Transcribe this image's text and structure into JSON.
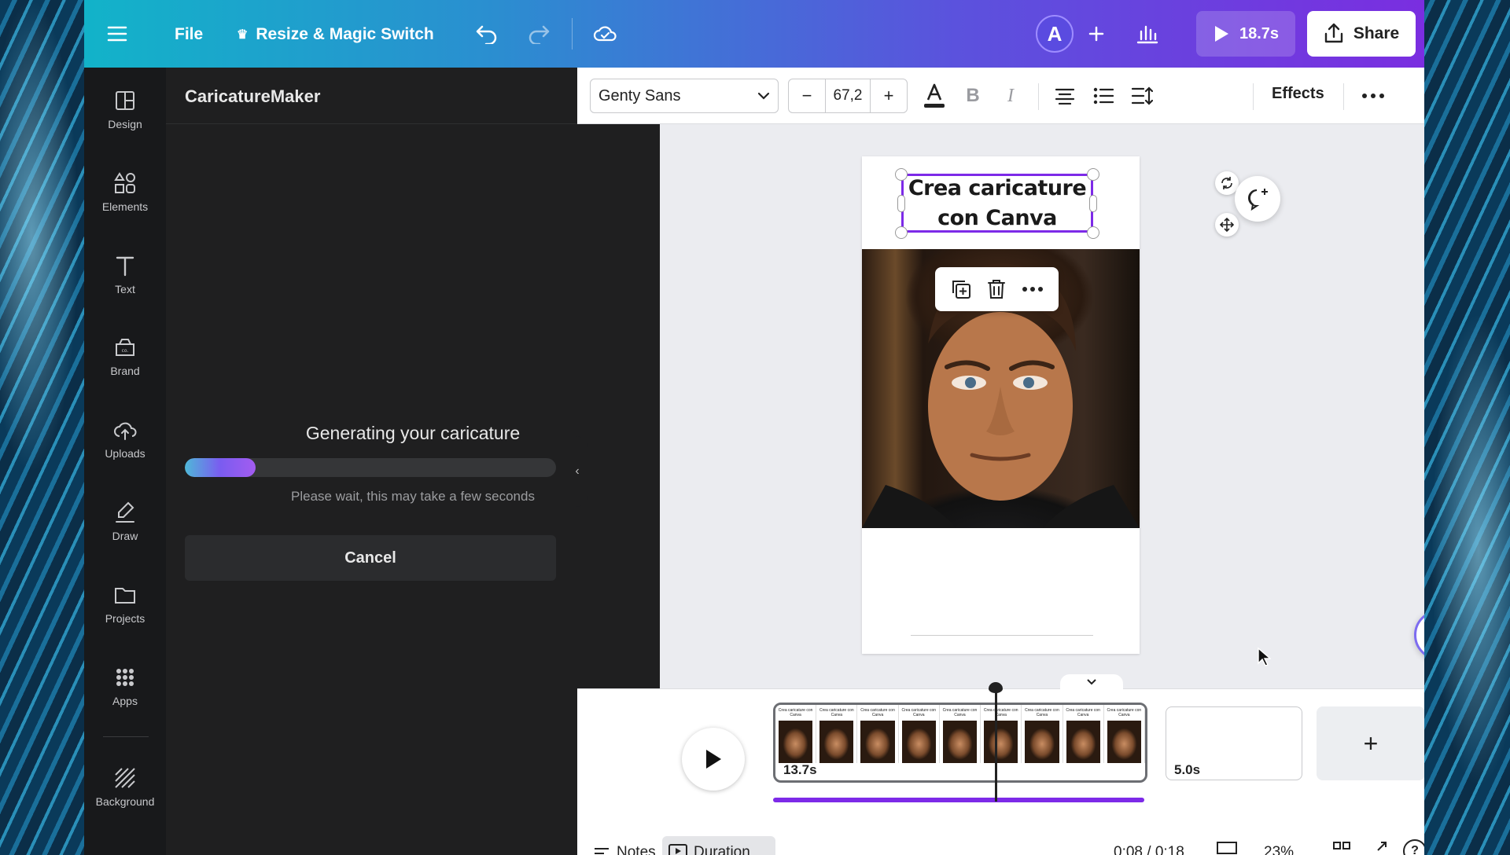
{
  "topbar": {
    "file": "File",
    "resize": "Resize & Magic Switch",
    "avatar": "A",
    "play_time": "18.7s",
    "share": "Share"
  },
  "rail": [
    {
      "label": "Design",
      "icon": "layout-icon"
    },
    {
      "label": "Elements",
      "icon": "shapes-icon"
    },
    {
      "label": "Text",
      "icon": "text-icon"
    },
    {
      "label": "Brand",
      "icon": "brand-icon"
    },
    {
      "label": "Uploads",
      "icon": "cloud-upload-icon"
    },
    {
      "label": "Draw",
      "icon": "draw-icon"
    },
    {
      "label": "Projects",
      "icon": "folder-icon"
    },
    {
      "label": "Apps",
      "icon": "apps-grid-icon"
    },
    {
      "label": "Background",
      "icon": "background-icon"
    }
  ],
  "panel": {
    "title": "CaricatureMaker",
    "generating": "Generating your caricature",
    "progress": 0.19,
    "wait": "Please wait, this may take a few seconds",
    "cancel": "Cancel"
  },
  "toolbar": {
    "font": "Genty Sans",
    "font_size": "67,2",
    "minus": "−",
    "plus": "+",
    "effects": "Effects"
  },
  "canvas": {
    "title_line1": "Crea caricature",
    "title_line2": "con Canva"
  },
  "timeline": {
    "clip1_duration": "13.7s",
    "clip2_duration": "5.0s",
    "thumb_text": "Crea caricature con Canva",
    "add": "+"
  },
  "footer": {
    "notes": "Notes",
    "duration": "Duration",
    "time": "0:08 / 0:18",
    "zoom": "23%"
  },
  "colors": {
    "accent": "#7d2ae8",
    "panel_bg": "#1f1f20",
    "rail_bg": "#18191b"
  }
}
